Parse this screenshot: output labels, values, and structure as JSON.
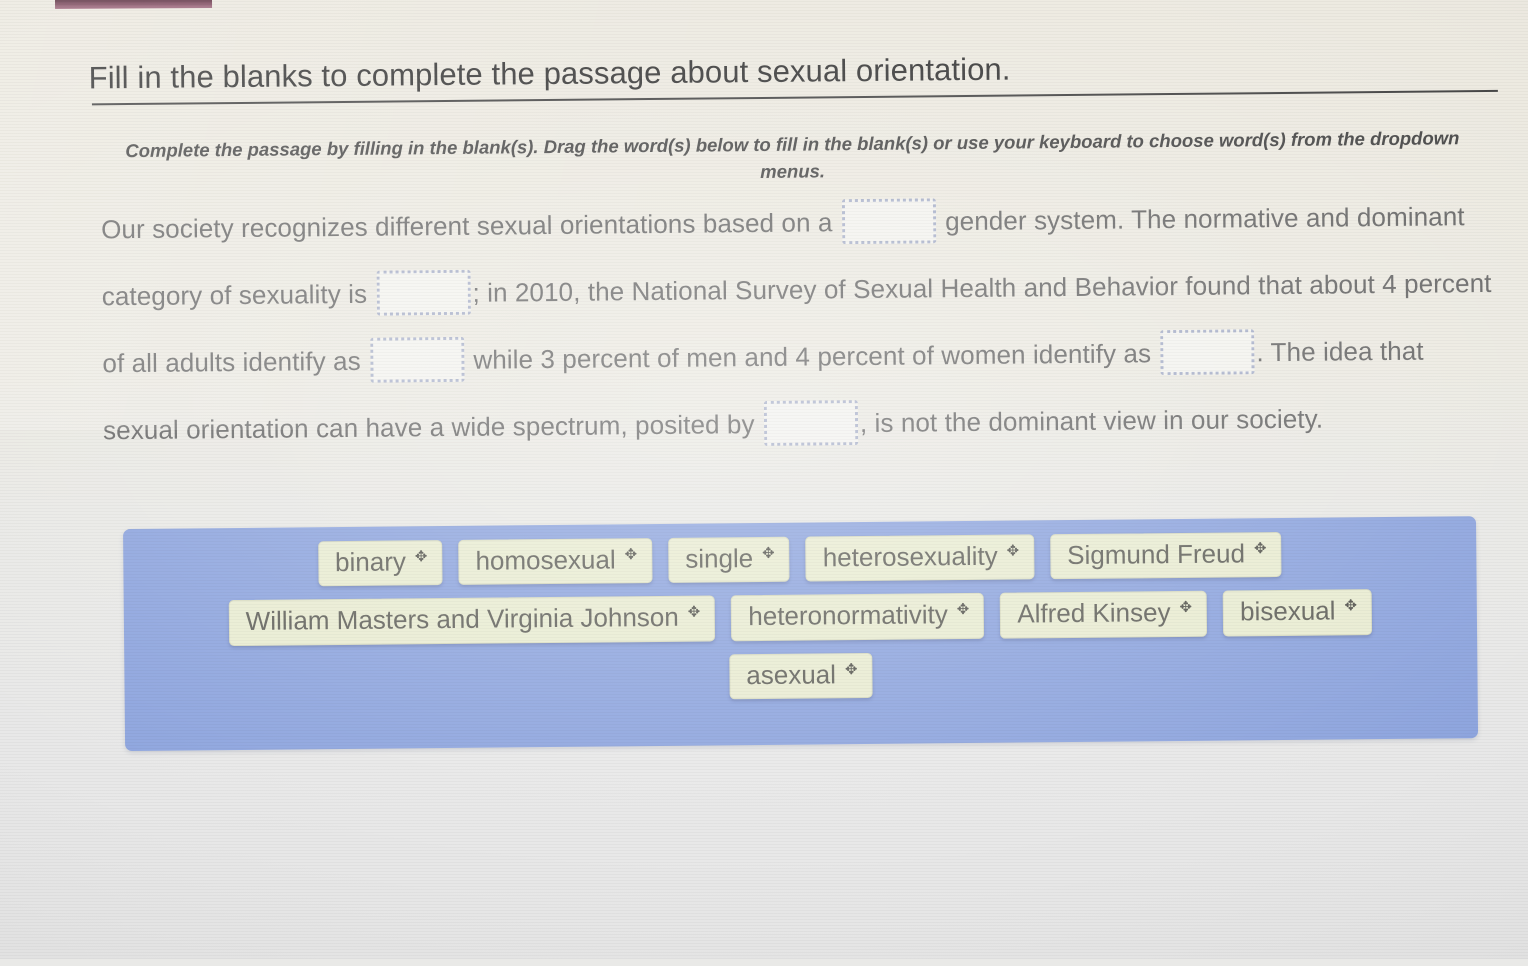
{
  "page": {
    "title": "Fill in the blanks to complete the passage about sexual orientation.",
    "instructions": "Complete the passage by filling in the blank(s). Drag the word(s) below to fill in the blank(s) or use your keyboard to choose word(s) from the dropdown menus.",
    "background_color": "#e9e9e7",
    "accent_bar_color": "#7d4a5e"
  },
  "passage": {
    "segments": [
      {
        "type": "text",
        "value": "Our society recognizes different sexual orientations based on a "
      },
      {
        "type": "blank",
        "index": 1,
        "value": ""
      },
      {
        "type": "text",
        "value": " gender system. The normative and dominant category of sexuality is "
      },
      {
        "type": "blank",
        "index": 2,
        "value": ""
      },
      {
        "type": "text",
        "value": "; in 2010, the National Survey of Sexual Health and Behavior found that about 4 percent of all adults identify as "
      },
      {
        "type": "blank",
        "index": 3,
        "value": ""
      },
      {
        "type": "text",
        "value": " while 3 percent of men and 4 percent of women identify as "
      },
      {
        "type": "blank",
        "index": 4,
        "value": ""
      },
      {
        "type": "text",
        "value": ". The idea that sexual orientation can have a wide spectrum, posited by "
      },
      {
        "type": "blank",
        "index": 5,
        "value": ""
      },
      {
        "type": "text",
        "value": ", is not the dominant view in our society."
      }
    ]
  },
  "word_bank": {
    "panel_color": "#8ea5de",
    "tile_color": "#e9ecd2",
    "drag_handle_icon": "move-cross-icon",
    "drag_handle_glyph": "✥",
    "rows": [
      [
        {
          "label": "binary"
        },
        {
          "label": "homosexual"
        },
        {
          "label": "single"
        },
        {
          "label": "heterosexuality"
        },
        {
          "label": "Sigmund Freud"
        }
      ],
      [
        {
          "label": "William Masters and Virginia Johnson"
        },
        {
          "label": "heteronormativity"
        },
        {
          "label": "Alfred Kinsey"
        },
        {
          "label": "bisexual"
        }
      ],
      [
        {
          "label": "asexual"
        }
      ]
    ]
  }
}
